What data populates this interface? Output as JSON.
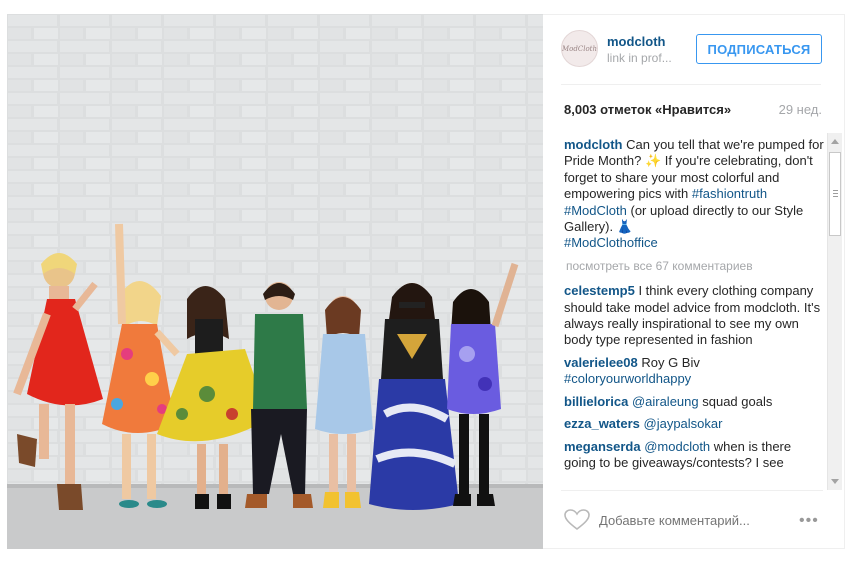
{
  "post": {
    "username": "modcloth",
    "profile_link": "link in prof...",
    "avatar_text": "ModCloth",
    "follow_label": "ПОДПИСАТЬСЯ",
    "likes": "8,003 отметок «Нравится»",
    "age": "29 нед.",
    "caption": {
      "user": "modcloth",
      "text_1": " Can you tell that we're pumped for Pride Month? ",
      "emoji_1": "✨",
      "text_2": " If you're celebrating, don't forget to share your most colorful and empowering pics with ",
      "tag_1": "#fashiontruth",
      "tag_2": "#ModCloth",
      "text_3": " (or upload directly to our Style Gallery). ",
      "emoji_2": "👗",
      "tag_3": "#ModClothoffice"
    },
    "view_all": "посмотреть все 67 комментариев",
    "comments": [
      {
        "user": "celestemp5",
        "text": " I think every clothing company should take model advice from modcloth. It's always really inspirational to see my own body type represented in fashion"
      },
      {
        "user": "valerielee08",
        "text": " Roy G Biv",
        "tag": "#coloryourworldhappy"
      },
      {
        "user": "billielorica",
        "mention": "@airaleung",
        "text": " squad goals"
      },
      {
        "user": "ezza_waters",
        "mention": "@jaypalsokar",
        "text": ""
      },
      {
        "user": "meganserda",
        "mention": "@modcloth",
        "text": " when is there going to be giveaways/contests? I see"
      }
    ],
    "add_comment_placeholder": "Добавьте комментарий...",
    "more_label": "•••"
  },
  "colors": {
    "link": "#125688",
    "follow": "#3897f0",
    "muted": "#a5a7aa"
  },
  "icons": {
    "like": "heart-outline-icon",
    "more": "ellipsis-icon"
  }
}
